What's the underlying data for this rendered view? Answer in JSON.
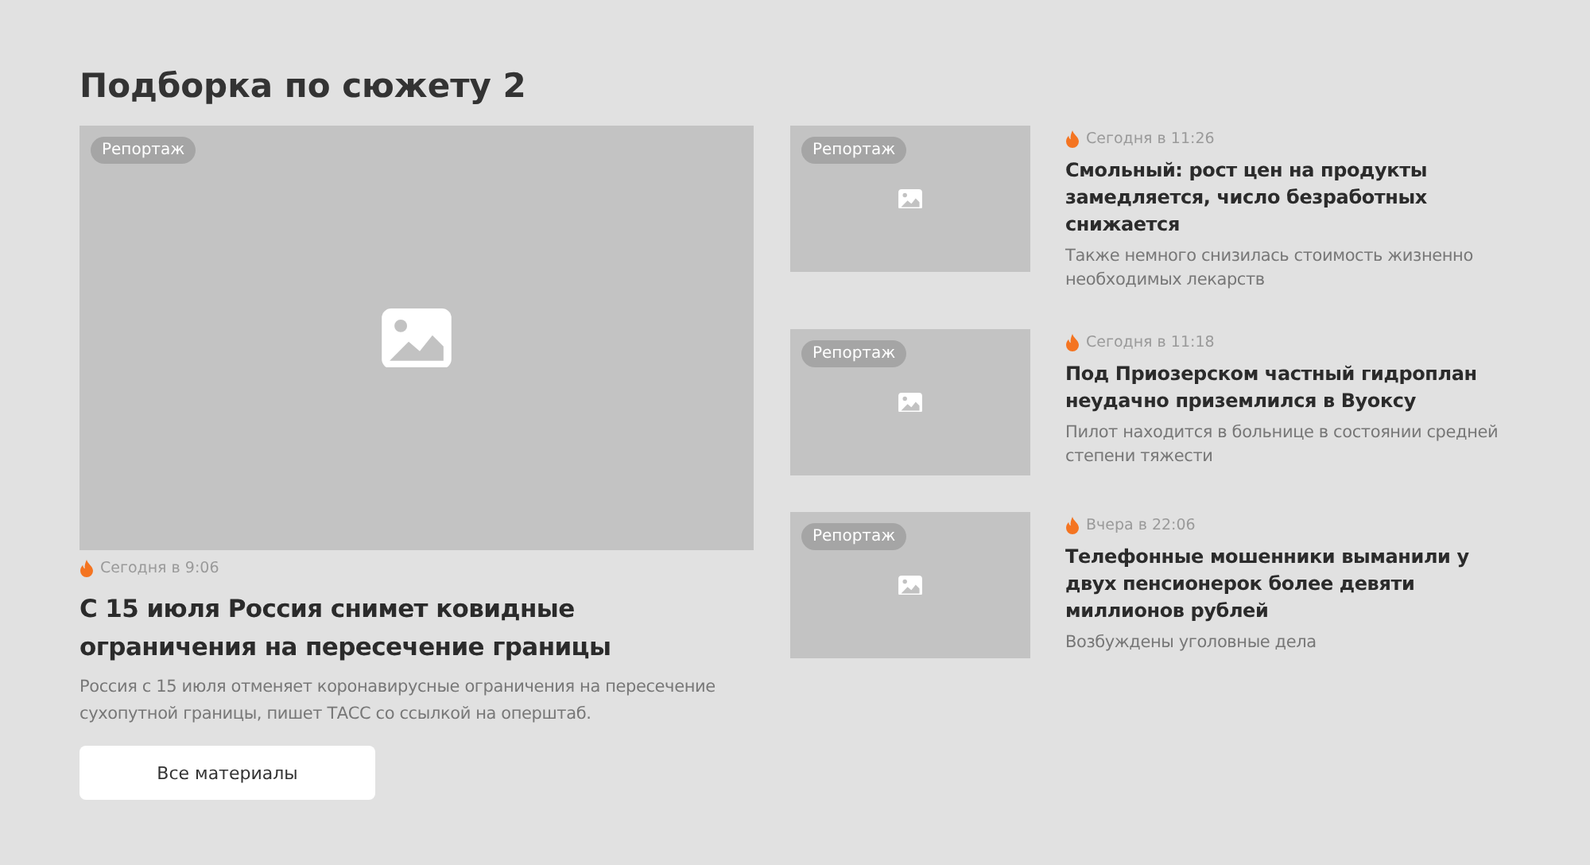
{
  "section_title": "Подборка по сюжету 2",
  "main_article": {
    "tag": "Репортаж",
    "time": "Сегодня в 9:06",
    "headline": "С 15 июля Россия снимет ковидные ограничения на пересечение границы",
    "summary": "Россия с 15 июля отменяет коронавирусные ограничения на пересечение сухопутной границы, пишет ТАСС со ссылкой на оперштаб."
  },
  "articles": [
    {
      "tag": "Репортаж",
      "time": "Сегодня в 11:26",
      "headline": "Смольный: рост цен на продукты замедляется, число безработных снижается",
      "summary": "Также немного снизилась стоимость жизненно необходимых лекарств"
    },
    {
      "tag": "Репортаж",
      "time": "Сегодня в 11:18",
      "headline": "Под Приозерском частный гидроплан неудачно приземлился в Вуоксу",
      "summary": "Пилот находится в больнице в состоянии средней степени тяжести"
    },
    {
      "tag": "Репортаж",
      "time": "Вчера в 22:06",
      "headline": "Телефонные мошенники выманили у двух пенсионерок более девяти миллионов рублей",
      "summary": "Возбуждены уголовные дела"
    }
  ],
  "all_button": "Все материалы"
}
